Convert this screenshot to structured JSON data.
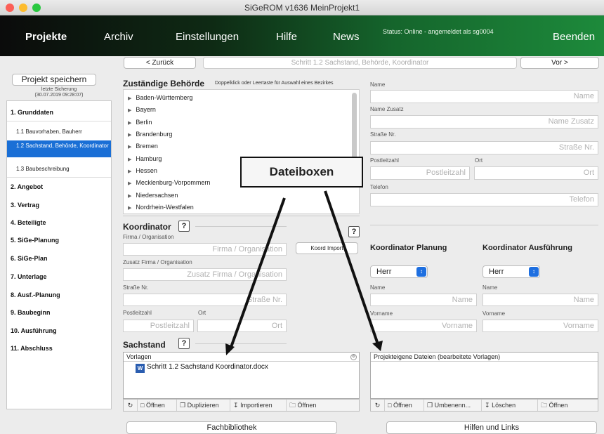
{
  "window": {
    "title": "SiGeROM  v1636   MeinProjekt1"
  },
  "nav": {
    "items": [
      "Projekte",
      "Archiv",
      "Einstellungen",
      "Hilfe",
      "News"
    ],
    "status": "Status: Online - angemeldet als sg0004",
    "quit": "Beenden"
  },
  "toolbar": {
    "back": "< Zurück",
    "step": "Schritt 1.2  Sachstand, Behörde, Koordinator",
    "forward": "Vor >"
  },
  "sidebar": {
    "save": "Projekt speichern",
    "last_save_label": "letzte Sicherung",
    "last_save_time": "(30.07.2019 09:28:07)",
    "items": [
      "1.  Grunddaten",
      "1.1 Bauvorhaben, Bauherr",
      "1.2 Sachstand, Behörde, Koordinator",
      "1.3 Baubeschreibung",
      "2.  Angebot",
      "3.  Vertrag",
      "4.  Beteiligte",
      "5.  SiGe-Planung",
      "6.  SiGe-Plan",
      "7.  Unterlage",
      "8.  Ausf.-Planung",
      "9.  Baubeginn",
      "10. Ausführung",
      "11. Abschluss"
    ]
  },
  "authority": {
    "title": "Zuständige Behörde",
    "hint": "Doppelklick oder Leertaste für Auswahl eines Bezirkes",
    "states": [
      "Baden-Württemberg",
      "Bayern",
      "Berlin",
      "Brandenburg",
      "Bremen",
      "Hamburg",
      "Hessen",
      "Mecklenburg-Vorpommern",
      "Niedersachsen",
      "Nordrhein-Westfalen"
    ]
  },
  "address": {
    "name_label": "Name",
    "name_ph": "Name",
    "zusatz_label": "Name Zusatz",
    "zusatz_ph": "Name Zusatz",
    "street_label": "Straße Nr.",
    "street_ph": "Straße Nr.",
    "zip_label": "Postleitzahl",
    "zip_ph": "Postleitzahl",
    "city_label": "Ort",
    "city_ph": "Ort",
    "phone_label": "Telefon",
    "phone_ph": "Telefon"
  },
  "coordinator": {
    "title": "Koordinator",
    "help": "?",
    "company_label": "Firma / Organisation",
    "company_ph": "Firma / Organisation",
    "import": "Koord Import",
    "zusatz_label": "Zusatz Firma / Organisation",
    "zusatz_ph": "Zusatz Firma / Organisation",
    "street_label": "Straße Nr.",
    "street_ph": "Straße Nr.",
    "zip_label": "Postleitzahl",
    "zip_ph": "Postleitzahl",
    "city_label": "Ort",
    "city_ph": "Ort"
  },
  "planning": {
    "title": "Koordinator Planung",
    "salutation": "Herr",
    "name_label": "Name",
    "name_ph": "Name",
    "first_label": "Vorname",
    "first_ph": "Vorname"
  },
  "execution": {
    "title": "Koordinator Ausführung",
    "salutation": "Herr",
    "name_label": "Name",
    "name_ph": "Name",
    "first_label": "Vorname",
    "first_ph": "Vorname"
  },
  "sachstand": {
    "title": "Sachstand",
    "help": "?",
    "templates_header": "Vorlagen",
    "template_file": "Schritt 1.2 Sachstand Koordinator.docx",
    "own_header": "Projekteigene Dateien (bearbeitete Vorlagen)",
    "left_tools": [
      "Öffnen",
      "Duplizieren",
      "Importieren",
      "Öffnen"
    ],
    "right_tools": [
      "Öffnen",
      "Umbenenn...",
      "Löschen",
      "Öffnen"
    ]
  },
  "callout": "Dateiboxen",
  "bottom": {
    "library": "Fachbibliothek",
    "help_links": "Hilfen und Links"
  },
  "colors": {
    "nav_dark": "#0b0b0b",
    "nav_green": "#1d8a3b",
    "selection": "#1a6fd6"
  }
}
